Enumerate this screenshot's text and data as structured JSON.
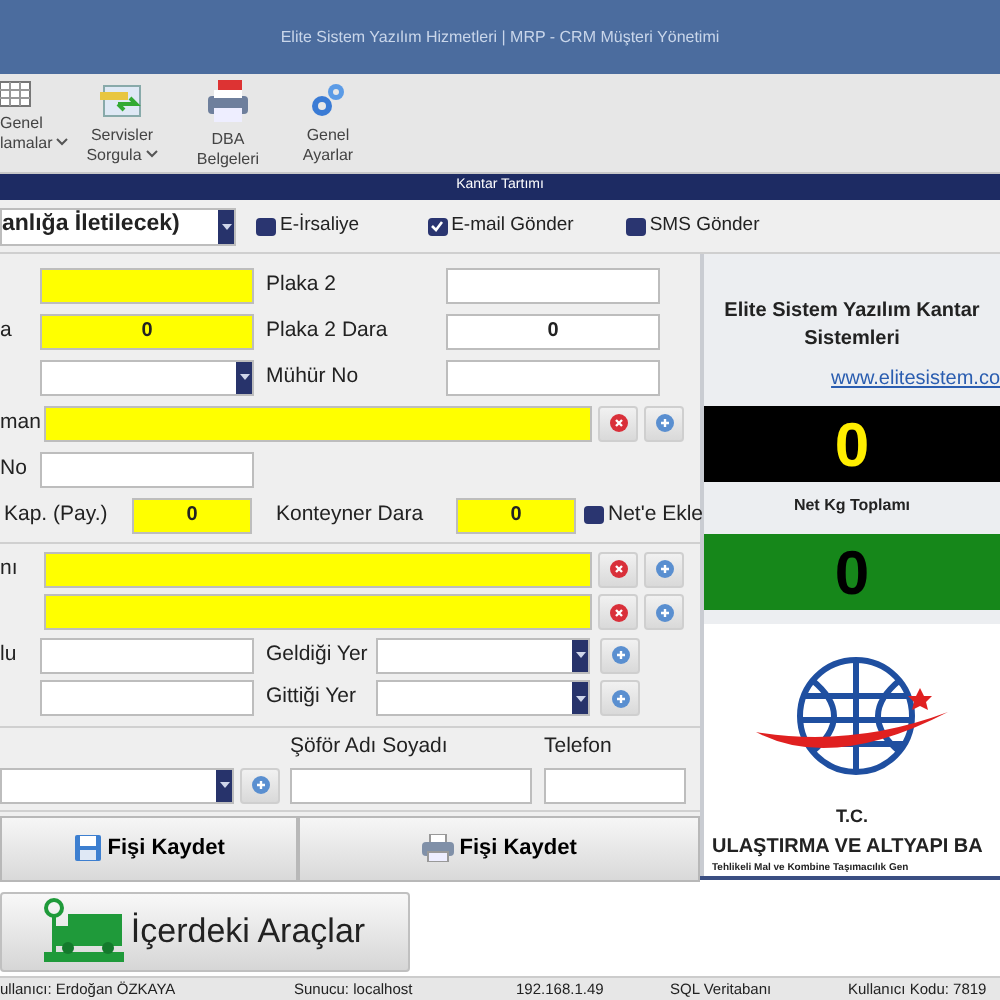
{
  "window": {
    "title": "Elite Sistem Yazılım Hizmetleri | MRP - CRM Müşteri Yönetimi"
  },
  "ribbon": [
    {
      "kind": "grid",
      "lines": [
        "Genel",
        "lamalar"
      ],
      "dropdown": true
    },
    {
      "kind": "transfer",
      "lines": [
        "Servisler",
        "Sorgula"
      ],
      "dropdown": true
    },
    {
      "kind": "pdf",
      "lines": [
        "DBA",
        "Belgeleri"
      ]
    },
    {
      "kind": "gears",
      "lines": [
        "Genel",
        "Ayarlar"
      ]
    }
  ],
  "section_title": "Kantar Tartımı",
  "top_row": {
    "select": {
      "value": "anlığa İletilecek)"
    },
    "checkboxes": [
      {
        "label": "E-İrsaliye",
        "checked": false
      },
      {
        "label": "E-mail Gönder",
        "checked": true
      },
      {
        "label": "SMS Gönder",
        "checked": false
      }
    ]
  },
  "sections": [
    {
      "rows": [
        {
          "kind": "pair",
          "field1": {
            "kind": "input",
            "required": true
          },
          "label2": "Plaka 2",
          "field2": {
            "kind": "input",
            "required": false
          }
        },
        {
          "kind": "pair",
          "label1": "a",
          "field1": {
            "kind": "input",
            "required": true,
            "value": "0"
          },
          "label2": "Plaka 2 Dara",
          "field2": {
            "kind": "input",
            "required": false,
            "value": "0"
          }
        },
        {
          "kind": "pair",
          "field1": {
            "kind": "select",
            "required": false
          },
          "label2": "Mühür No",
          "field2": {
            "kind": "input",
            "required": false
          }
        },
        {
          "kind": "wide",
          "label1": "man",
          "field1": {
            "kind": "input",
            "required": true
          },
          "buttons": [
            {
              "kind": "remove"
            },
            {
              "kind": "add"
            }
          ]
        },
        {
          "kind": "pair",
          "label1": "No",
          "field1": {
            "kind": "input",
            "required": false
          }
        },
        {
          "kind": "tare",
          "label1": "Kap. (Pay.)",
          "field1": {
            "kind": "input",
            "required": true,
            "value": "0"
          },
          "label2": "Konteyner Dara",
          "field2": {
            "kind": "input",
            "required": true,
            "value": "0"
          },
          "checkbox": {
            "label": "Net'e Ekle",
            "checked": false
          }
        }
      ]
    },
    {
      "rows": [
        {
          "kind": "wide",
          "label1": "nı",
          "field1": {
            "kind": "input",
            "required": true
          },
          "buttons": [
            {
              "kind": "remove"
            },
            {
              "kind": "add"
            }
          ]
        },
        {
          "kind": "wide",
          "field1": {
            "kind": "input",
            "required": true
          },
          "buttons": [
            {
              "kind": "remove"
            },
            {
              "kind": "add"
            }
          ]
        },
        {
          "kind": "place",
          "label1": "lu",
          "field1": {
            "kind": "input",
            "required": false
          },
          "label2": "Geldiği Yer",
          "field2": {
            "kind": "select",
            "required": false
          },
          "buttons": [
            {
              "kind": "add"
            }
          ]
        },
        {
          "kind": "place",
          "field1": {
            "kind": "input",
            "required": false
          },
          "label2": "Gittiği Yer",
          "field2": {
            "kind": "select",
            "required": false
          },
          "buttons": [
            {
              "kind": "add"
            }
          ]
        }
      ]
    },
    {
      "rows": [
        {
          "kind": "driver",
          "field1": {
            "kind": "select",
            "required": false
          },
          "buttons": [
            {
              "kind": "add"
            }
          ],
          "label2": "Şöför Adı Soyadı",
          "field2": {
            "kind": "input",
            "required": false
          },
          "label3": "Telefon",
          "field3": {
            "kind": "input",
            "required": false
          }
        }
      ]
    }
  ],
  "actions": [
    {
      "kind": "save",
      "label": "Fişi Kaydet"
    },
    {
      "kind": "print",
      "label": "Fişi Kaydet"
    }
  ],
  "right_panel": {
    "title": "Elite Sistem Yazılım Kantar Sistemleri",
    "link": "www.elitesistem.co",
    "weight": "0",
    "net_label": "Net Kg Toplamı",
    "net_weight": "0",
    "logo": {
      "line1": "T.C.",
      "line2": "ULAŞTIRMA VE ALTYAPI BA",
      "line3": "Tehlikeli Mal ve Kombine Taşımacılık Gen"
    }
  },
  "inside_button": {
    "label": "İçerdeki Araçlar"
  },
  "status_bar": [
    "ullanıcı: Erdoğan ÖZKAYA",
    "Sunucu: localhost",
    "192.168.1.49",
    "SQL Veritabanı",
    "Kullanıcı Kodu: 7819"
  ]
}
